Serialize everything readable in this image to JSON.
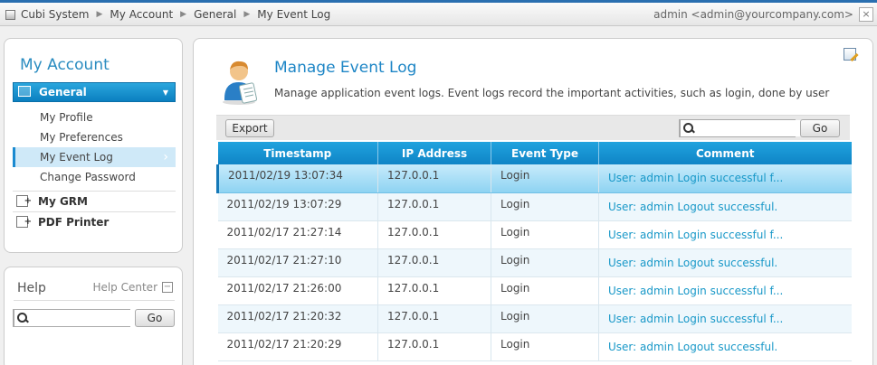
{
  "breadcrumb": [
    "Cubi System",
    "My Account",
    "General",
    "My Event Log"
  ],
  "user_label": "admin <admin@yourcompany.com>",
  "sidebar": {
    "title": "My Account",
    "group": "General",
    "items": [
      {
        "label": "My Profile",
        "active": false
      },
      {
        "label": "My Preferences",
        "active": false
      },
      {
        "label": "My Event Log",
        "active": true
      },
      {
        "label": "Change Password",
        "active": false
      }
    ],
    "sections": [
      {
        "label": "My GRM"
      },
      {
        "label": "PDF Printer"
      }
    ]
  },
  "help": {
    "title": "Help",
    "center_label": "Help Center",
    "search_placeholder": "",
    "go_label": "Go"
  },
  "main": {
    "title": "Manage Event Log",
    "description": "Manage application event logs. Event logs record the important activities, such as login, done by user",
    "export_label": "Export",
    "search_placeholder": "",
    "go_label": "Go",
    "columns": [
      "Timestamp",
      "IP Address",
      "Event Type",
      "Comment"
    ],
    "rows": [
      {
        "timestamp": "2011/02/19 13:07:34",
        "ip": "127.0.0.1",
        "event": "Login",
        "comment": "User: admin Login successful f..."
      },
      {
        "timestamp": "2011/02/19 13:07:29",
        "ip": "127.0.0.1",
        "event": "Login",
        "comment": "User: admin Logout successful."
      },
      {
        "timestamp": "2011/02/17 21:27:14",
        "ip": "127.0.0.1",
        "event": "Login",
        "comment": "User: admin Login successful f..."
      },
      {
        "timestamp": "2011/02/17 21:27:10",
        "ip": "127.0.0.1",
        "event": "Login",
        "comment": "User: admin Logout successful."
      },
      {
        "timestamp": "2011/02/17 21:26:00",
        "ip": "127.0.0.1",
        "event": "Login",
        "comment": "User: admin Login successful f..."
      },
      {
        "timestamp": "2011/02/17 21:20:32",
        "ip": "127.0.0.1",
        "event": "Login",
        "comment": "User: admin Login successful f..."
      },
      {
        "timestamp": "2011/02/17 21:20:29",
        "ip": "127.0.0.1",
        "event": "Login",
        "comment": "User: admin Logout successful."
      }
    ]
  },
  "colors": {
    "accent": "#1e86c6",
    "header_bar": "#2a6fb0",
    "selected_row": "#8ed3f2"
  }
}
